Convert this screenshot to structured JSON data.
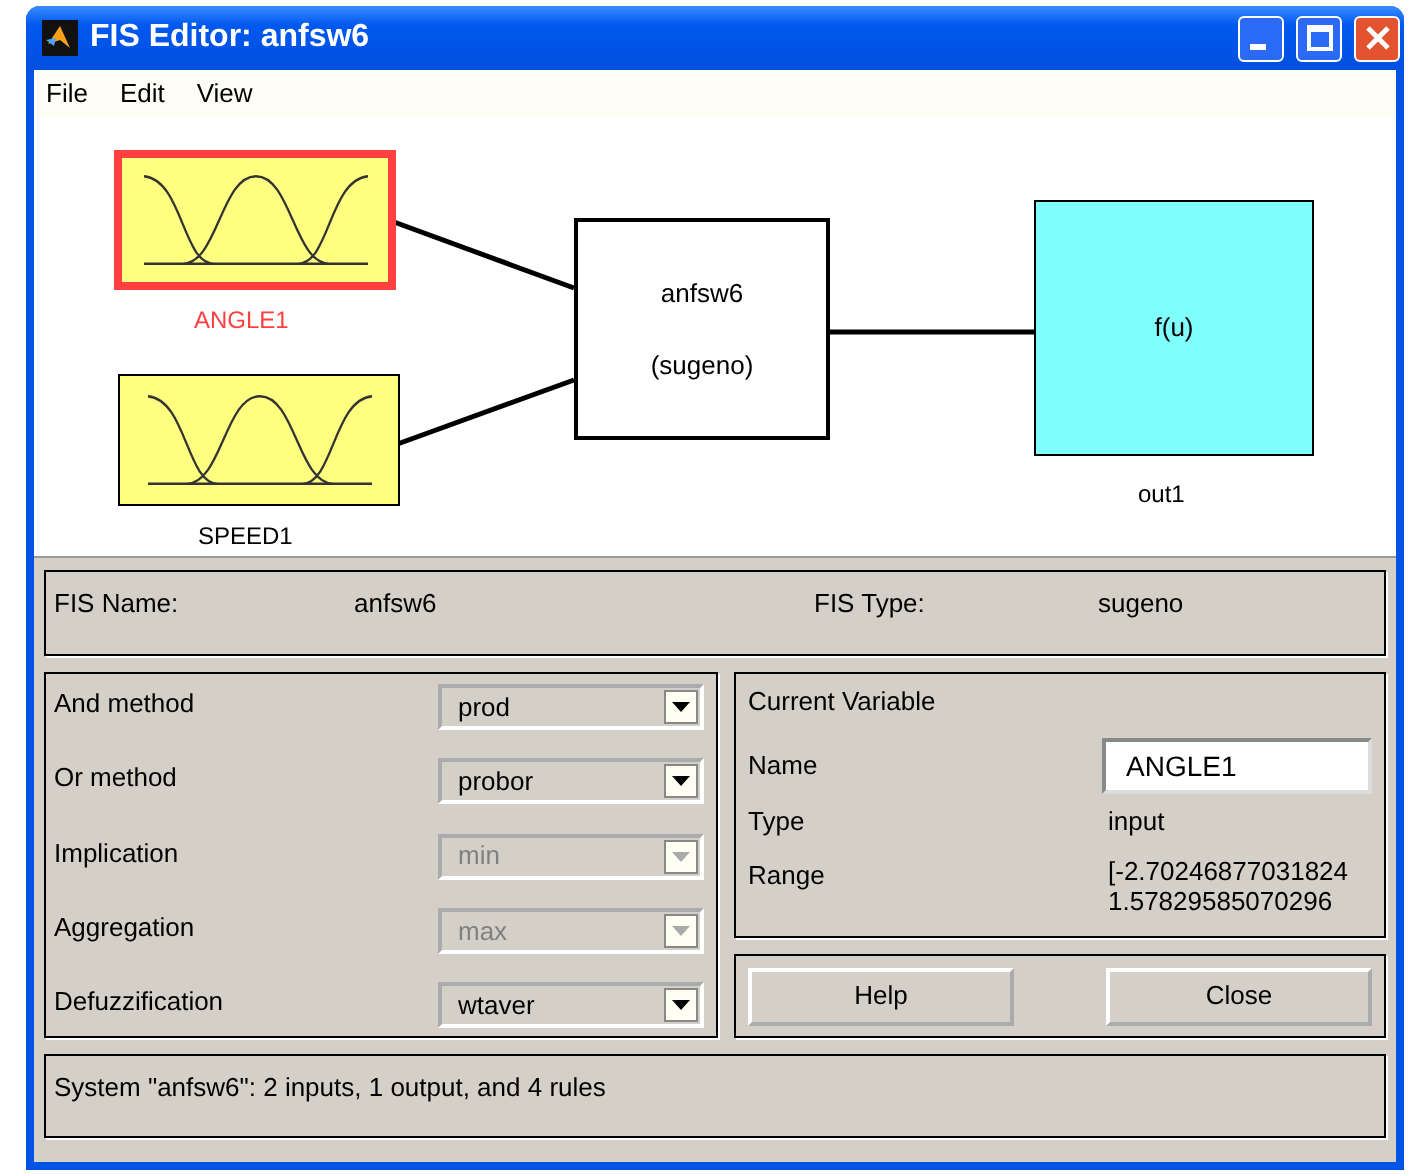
{
  "window": {
    "title": "FIS Editor: anfsw6"
  },
  "menu": [
    "File",
    "Edit",
    "View"
  ],
  "inputs": [
    {
      "name": "ANGLE1",
      "selected": true
    },
    {
      "name": "SPEED1",
      "selected": false
    }
  ],
  "system_block": {
    "name": "anfsw6",
    "type": "(sugeno)"
  },
  "output_block": {
    "function": "f(u)",
    "name": "out1"
  },
  "fis_info": [
    {
      "label": "FIS Name:",
      "value": "anfsw6"
    },
    {
      "label": "FIS Type:",
      "value": "sugeno"
    }
  ],
  "methods": [
    {
      "label": "And method",
      "value": "prod",
      "disabled": false
    },
    {
      "label": "Or method",
      "value": "probor",
      "disabled": false
    },
    {
      "label": "Implication",
      "value": "min",
      "disabled": true
    },
    {
      "label": "Aggregation",
      "value": "max",
      "disabled": true
    },
    {
      "label": "Defuzzification",
      "value": "wtaver",
      "disabled": false
    }
  ],
  "current_variable": {
    "title": "Current Variable",
    "name_label": "Name",
    "name_value": "ANGLE1",
    "type_label": "Type",
    "type_value": "input",
    "range_label": "Range",
    "range_lines": [
      "[-2.70246877031824",
      "1.57829585070296"
    ]
  },
  "buttons": [
    "Help",
    "Close"
  ],
  "status": "System \"anfsw6\": 2 inputs, 1 output, and 4 rules"
}
